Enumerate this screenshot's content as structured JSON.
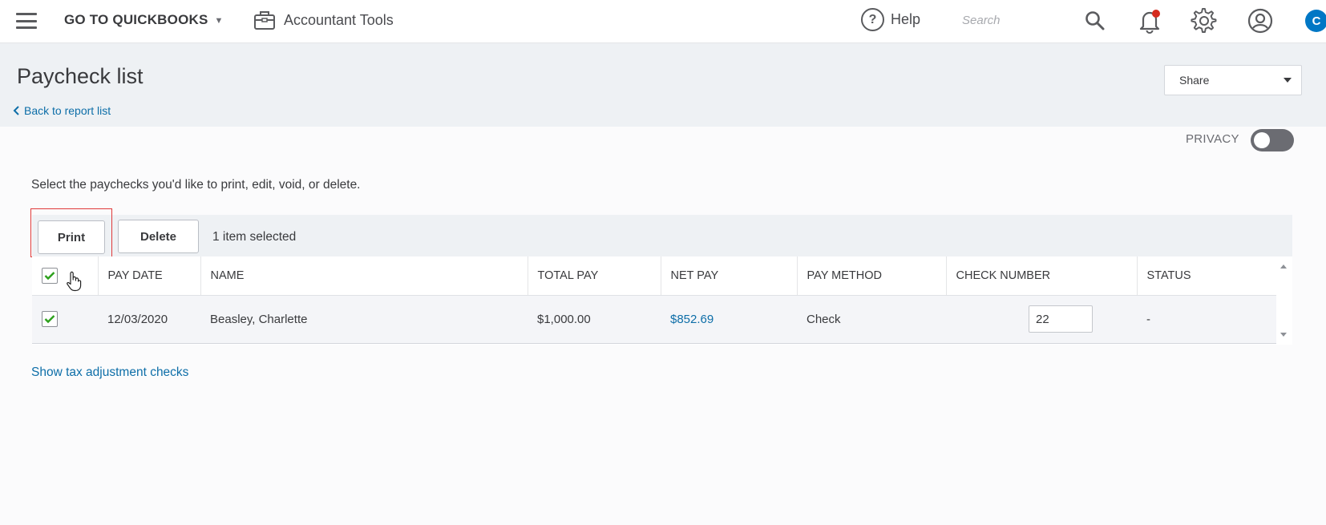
{
  "topbar": {
    "goto_label": "GO TO QUICKBOOKS",
    "accountant_tools": "Accountant Tools",
    "help_label": "Help",
    "search_placeholder": "Search",
    "avatar_initial": "C"
  },
  "page": {
    "title": "Paycheck list",
    "back_link": "Back to report list",
    "share_label": "Share",
    "privacy_label": "PRIVACY",
    "privacy_enabled": false,
    "instructions": "Select the paychecks you'd like to print, edit, void, or delete.",
    "print_label": "Print",
    "delete_label": "Delete",
    "selected_count": "1 item selected",
    "show_tax_link": "Show tax adjustment checks"
  },
  "table": {
    "columns": [
      "PAY DATE",
      "NAME",
      "TOTAL PAY",
      "NET PAY",
      "PAY METHOD",
      "CHECK NUMBER",
      "STATUS"
    ],
    "rows": [
      {
        "selected": true,
        "pay_date": "12/03/2020",
        "name": "Beasley, Charlette",
        "total_pay": "$1,000.00",
        "net_pay": "$852.69",
        "pay_method": "Check",
        "check_number": "22",
        "status": "-"
      }
    ]
  },
  "colors": {
    "accent_blue": "#0077c5",
    "link_blue": "#0d6ea8",
    "check_green": "#2ca01c",
    "highlight_red": "#e03a3a"
  }
}
